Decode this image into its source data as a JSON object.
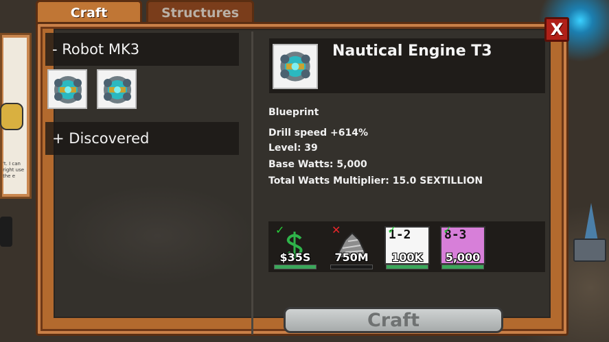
{
  "tabs": [
    {
      "label": "Craft",
      "active": true
    },
    {
      "label": "Structures",
      "active": false
    }
  ],
  "close_label": "X",
  "categories": [
    {
      "label": "- Robot MK3",
      "expanded": true
    },
    {
      "label": "+ Discovered",
      "expanded": false
    }
  ],
  "item_icons": [
    "nautical-engine-icon",
    "nautical-engine-icon"
  ],
  "detail": {
    "title": "Nautical Engine T3",
    "type": "Blueprint",
    "stats": [
      "Drill speed +614%",
      "Level: 39",
      "Base Watts: 5,000",
      "Total Watts Multiplier: 15.0 SEXTILLION"
    ]
  },
  "requirements": [
    {
      "name": "money",
      "amount": "$35S",
      "met": true,
      "progress": 1.0
    },
    {
      "name": "ore",
      "amount": "750M",
      "met": false,
      "progress": 0.0
    },
    {
      "name": "blueprint-1-2",
      "glyph": "1-2",
      "amount": "100K",
      "met": true,
      "progress": 1.0
    },
    {
      "name": "blueprint-8-3",
      "glyph": "8-3",
      "amount": "5,000",
      "met": true,
      "progress": 1.0
    }
  ],
  "craft_label": "Craft",
  "side_card_text": "'t. I can right use the e",
  "colors": {
    "frame": "#b36a2e",
    "ok": "#28d23a",
    "error": "#e8262a",
    "progress": "#3aa85a"
  }
}
